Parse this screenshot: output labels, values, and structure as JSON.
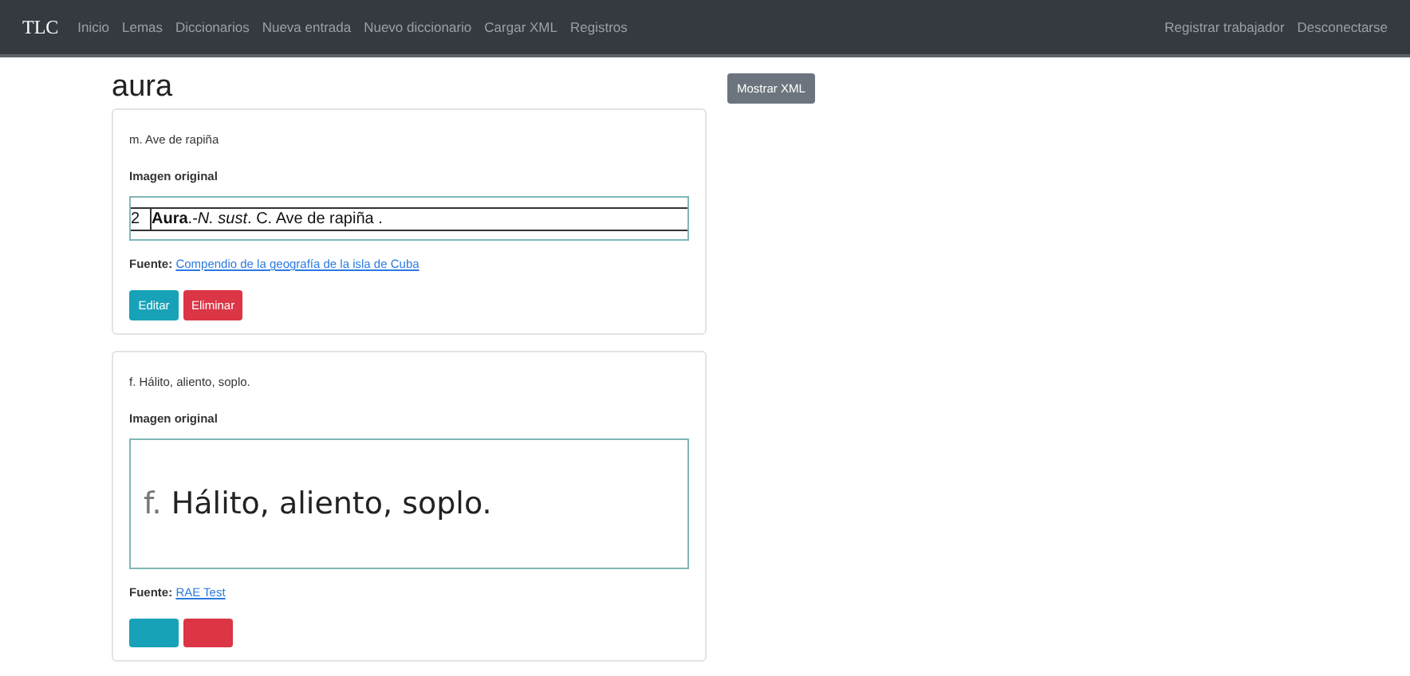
{
  "navbar": {
    "brand": "TLC",
    "links": [
      {
        "label": "Inicio"
      },
      {
        "label": "Lemas"
      },
      {
        "label": "Diccionarios"
      },
      {
        "label": "Nueva entrada"
      },
      {
        "label": "Nuevo diccionario"
      },
      {
        "label": "Cargar XML"
      },
      {
        "label": "Registros"
      }
    ],
    "right_links": [
      {
        "label": "Registrar trabajador"
      },
      {
        "label": "Desconectarse"
      }
    ]
  },
  "heading": "aura",
  "show_xml_button": "Mostrar XML",
  "entries": [
    {
      "definition": "m. Ave de rapiña",
      "image_heading": "Imagen original",
      "image": {
        "kind": "scan",
        "number": "2",
        "headword": "Aura",
        "rest": ".-*N. sust*. C. Ave de rapiña ."
      },
      "source_label": "Fuente:",
      "source_link": "Compendio de la geografía de la isla de Cuba",
      "buttons": [
        {
          "kind": "edit",
          "label": "Editar"
        },
        {
          "kind": "delete",
          "label": "Eliminar"
        }
      ]
    },
    {
      "definition": "f. Hálito, aliento, soplo.",
      "image_heading": "Imagen original",
      "image": {
        "kind": "print",
        "abbr": "f.",
        "text": "Hálito, aliento, soplo."
      },
      "source_label": "Fuente:",
      "source_link": "RAE Test",
      "buttons": [
        {
          "kind": "edit"
        },
        {
          "kind": "delete"
        }
      ]
    }
  ]
}
